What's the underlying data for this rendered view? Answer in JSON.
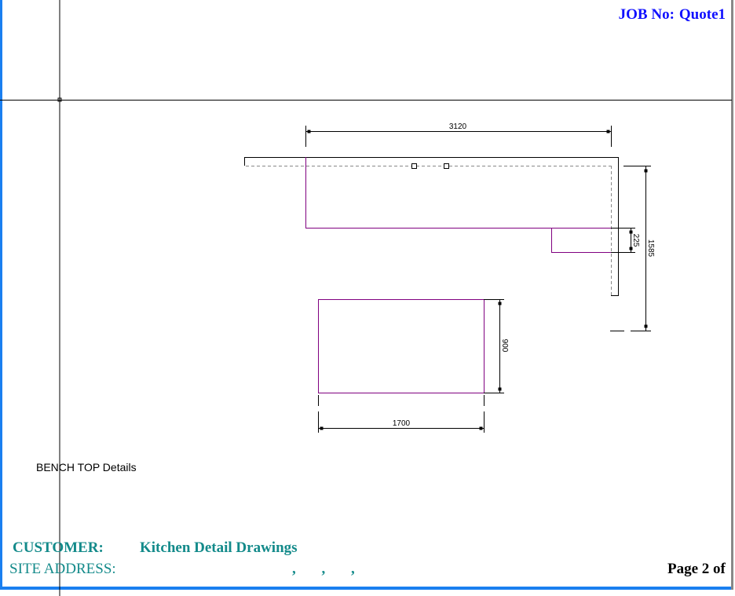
{
  "header": {
    "job_label": "JOB No:",
    "job_value": "Quote1"
  },
  "drawing": {
    "dimensions": {
      "top_width": "3120",
      "step_depth": "225",
      "right_depth": "1585",
      "island_depth": "900",
      "island_width": "1700"
    },
    "colors": {
      "outline": "#800080",
      "dimension": "#000000"
    }
  },
  "caption": "BENCH TOP Details",
  "footer": {
    "customer_label": "CUSTOMER:",
    "customer_value": "Kitchen Detail Drawings",
    "site_label": "SITE ADDRESS:",
    "site_value": ",  ,  ,",
    "page": "Page 2 of"
  }
}
